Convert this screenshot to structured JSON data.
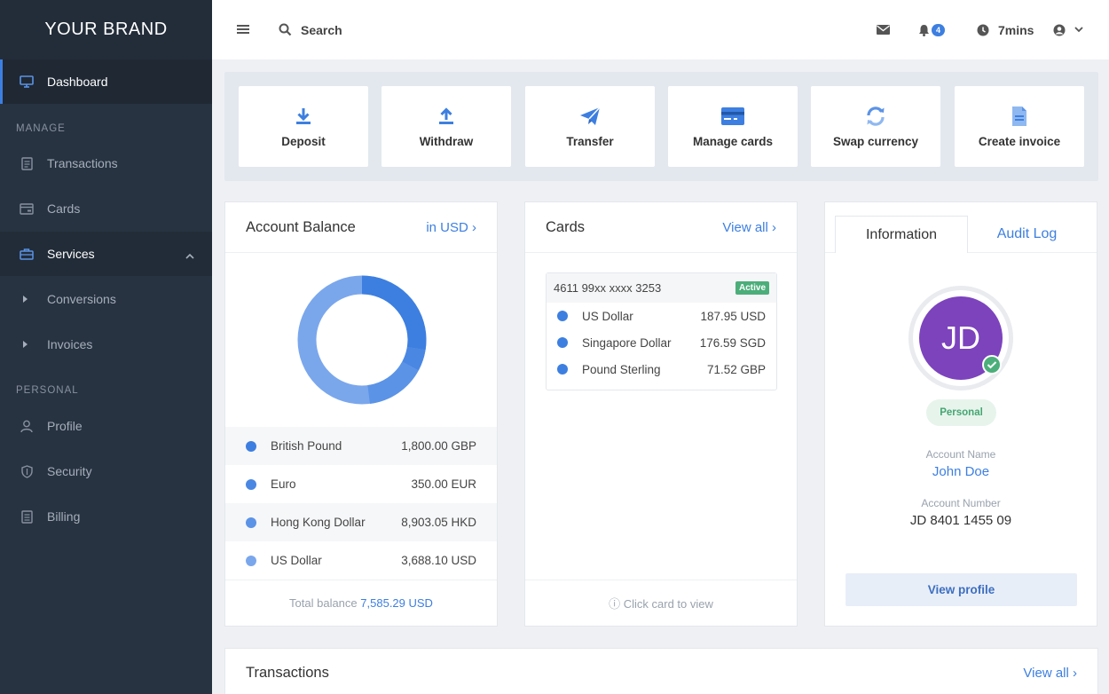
{
  "brand": "YOUR BRAND",
  "sidebar": {
    "dashboard": "Dashboard",
    "manage_heading": "MANAGE",
    "transactions": "Transactions",
    "cards": "Cards",
    "services": "Services",
    "conversions": "Conversions",
    "invoices": "Invoices",
    "personal_heading": "PERSONAL",
    "profile": "Profile",
    "security": "Security",
    "billing": "Billing"
  },
  "topbar": {
    "search_label": "Search",
    "notification_count": "4",
    "session_time": "7mins"
  },
  "actions": [
    {
      "label": "Deposit",
      "icon": "download-icon"
    },
    {
      "label": "Withdraw",
      "icon": "upload-icon"
    },
    {
      "label": "Transfer",
      "icon": "paper-plane-icon"
    },
    {
      "label": "Manage cards",
      "icon": "credit-card-icon"
    },
    {
      "label": "Swap currency",
      "icon": "refresh-icon"
    },
    {
      "label": "Create invoice",
      "icon": "invoice-icon"
    }
  ],
  "balance": {
    "title": "Account Balance",
    "currency_link": "in USD ›",
    "rows": [
      {
        "name": "British Pound",
        "amount": "1,800.00 GBP",
        "color": "#3d7fe0"
      },
      {
        "name": "Euro",
        "amount": "350.00 EUR",
        "color": "#4a87e3"
      },
      {
        "name": "Hong Kong Dollar",
        "amount": "8,903.05 HKD",
        "color": "#5b93e6"
      },
      {
        "name": "US Dollar",
        "amount": "3,688.10 USD",
        "color": "#7aa7ec"
      }
    ],
    "total_label": "Total balance",
    "total_value": "7,585.29 USD"
  },
  "cards_panel": {
    "title": "Cards",
    "view_all": "View all ›",
    "card_number": "4611 99xx xxxx 3253",
    "status": "Active",
    "rows": [
      {
        "name": "US Dollar",
        "amount": "187.95 USD"
      },
      {
        "name": "Singapore Dollar",
        "amount": "176.59 SGD"
      },
      {
        "name": "Pound Sterling",
        "amount": "71.52 GBP"
      }
    ],
    "footer": "ⓘ Click card to view"
  },
  "info_panel": {
    "tab_info": "Information",
    "tab_audit": "Audit Log",
    "initials": "JD",
    "account_type": "Personal",
    "account_name_label": "Account Name",
    "account_name": "John Doe",
    "account_number_label": "Account Number",
    "account_number": "JD 8401 1455 09",
    "view_profile": "View profile"
  },
  "transactions_panel": {
    "title": "Transactions",
    "view_all": "View all ›"
  }
}
